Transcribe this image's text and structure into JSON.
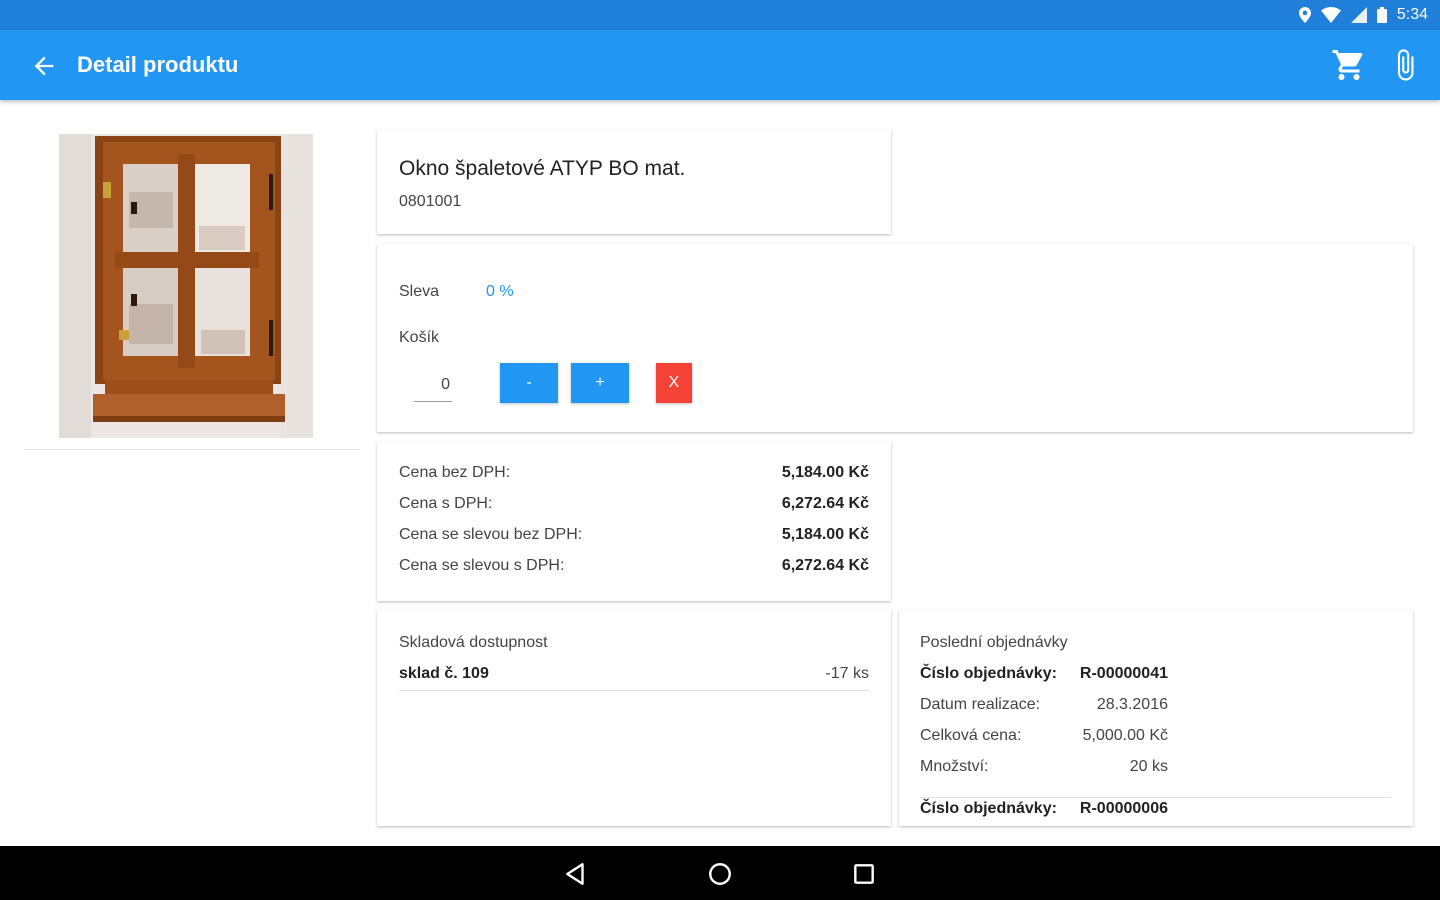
{
  "status": {
    "time": "5:34"
  },
  "appbar": {
    "title": "Detail produktu"
  },
  "product": {
    "name": "Okno špaletové ATYP BO mat.",
    "code": "0801001"
  },
  "cart": {
    "discount_label": "Sleva",
    "discount_value": "0 %",
    "basket_label": "Košík",
    "quantity": "0",
    "minus_label": "-",
    "plus_label": "+",
    "remove_label": "X"
  },
  "prices": [
    {
      "label": "Cena bez DPH:",
      "value": "5,184.00 Kč"
    },
    {
      "label": "Cena s DPH:",
      "value": "6,272.64 Kč"
    },
    {
      "label": "Cena se slevou bez DPH:",
      "value": "5,184.00 Kč"
    },
    {
      "label": "Cena se slevou s DPH:",
      "value": "6,272.64 Kč"
    }
  ],
  "stock": {
    "title": "Skladová dostupnost",
    "rows": [
      {
        "warehouse": "sklad č. 109",
        "amount": "-17 ks"
      }
    ]
  },
  "orders": {
    "title": "Poslední objednávky",
    "items": [
      {
        "number_label": "Číslo objednávky:",
        "number": "R-00000041",
        "date_label": "Datum realizace:",
        "date": "28.3.2016",
        "total_label": "Celková cena:",
        "total": "5,000.00 Kč",
        "qty_label": "Množství:",
        "qty": "20 ks"
      },
      {
        "number_label": "Číslo objednávky:",
        "number": "R-00000006"
      }
    ]
  },
  "colors": {
    "primary": "#2196f3",
    "status_bar": "#1f7fd9",
    "danger": "#f44336"
  }
}
